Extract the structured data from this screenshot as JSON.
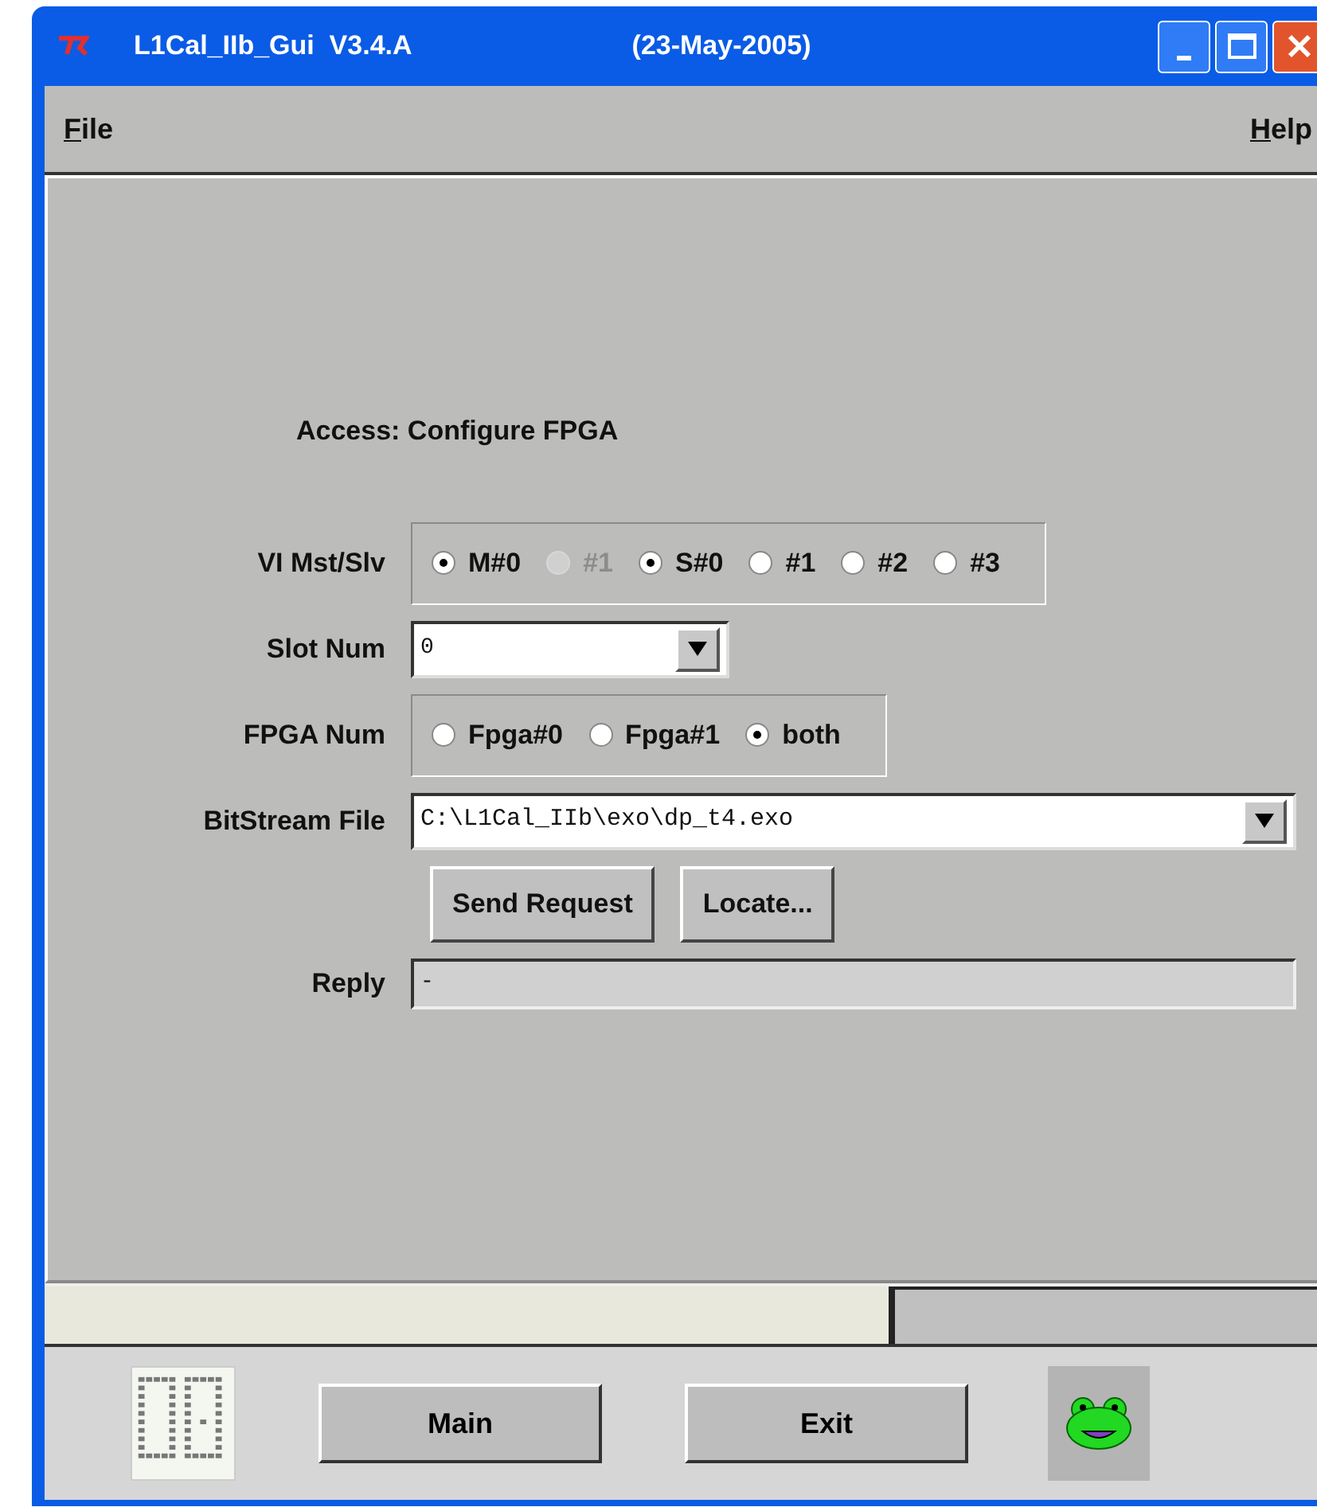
{
  "window": {
    "title": "L1Cal_IIb_Gui  V3.4.A",
    "date": "(23-May-2005)"
  },
  "menu": [
    {
      "label": "File"
    },
    {
      "label": "Help"
    }
  ],
  "access": "Access: Configure FPGA",
  "rows": [
    {
      "kind": "radio-group",
      "label": "VI Mst/Slv",
      "options": [
        {
          "label": "M#0",
          "selected": true,
          "disabled": false
        },
        {
          "label": "#1",
          "selected": false,
          "disabled": true
        },
        {
          "label": "S#0",
          "selected": true,
          "disabled": false
        },
        {
          "label": "#1",
          "selected": false,
          "disabled": false
        },
        {
          "label": "#2",
          "selected": false,
          "disabled": false
        },
        {
          "label": "#3",
          "selected": false,
          "disabled": false
        }
      ]
    },
    {
      "kind": "dropdown",
      "label": "Slot Num",
      "value": "0"
    },
    {
      "kind": "radio-group",
      "label": "FPGA Num",
      "options": [
        {
          "label": "Fpga#0",
          "selected": false,
          "disabled": false
        },
        {
          "label": "Fpga#1",
          "selected": false,
          "disabled": false
        },
        {
          "label": "both",
          "selected": true,
          "disabled": false
        }
      ]
    },
    {
      "kind": "combo",
      "label": "BitStream File",
      "value": "C:\\L1Cal_IIb\\exo\\dp_t4.exo"
    },
    {
      "kind": "buttons",
      "buttons": [
        "Send Request",
        "Locate..."
      ]
    },
    {
      "kind": "field",
      "label": "Reply",
      "value": "-"
    }
  ],
  "footer_buttons": [
    "Main",
    "Exit"
  ]
}
